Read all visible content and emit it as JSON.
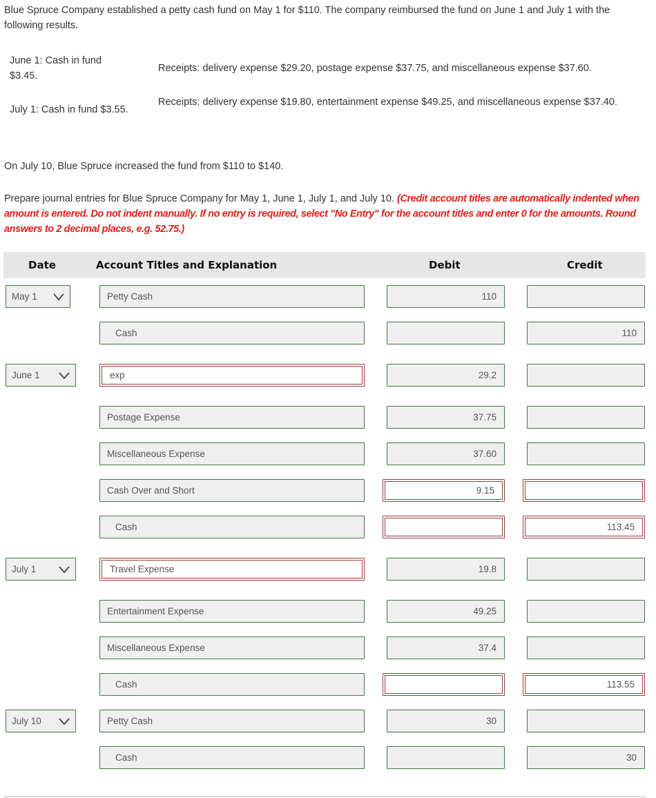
{
  "problem": {
    "intro": "Blue Spruce Company established a petty cash fund on May 1 for $110. The company reimbursed the fund on June 1 and July 1 with the following results.",
    "results": [
      {
        "date": "June 1: Cash in fund $3.45.",
        "receipts": "Receipts: delivery expense $29.20, postage expense $37.75, and miscellaneous expense $37.60."
      },
      {
        "date": "July 1: Cash in fund $3.55.",
        "receipts": "Receipts: delivery expense $19.80, entertainment expense $49.25, and miscellaneous expense $37.40."
      }
    ],
    "increase": "On July 10, Blue Spruce increased the fund from $110 to $140.",
    "instruction_plain": "Prepare journal entries for Blue Spruce Company for May 1, June 1, July 1, and July 10. ",
    "instruction_red": "(Credit account titles are automatically indented when amount is entered. Do not indent manually. If no entry is required, select \"No Entry\" for the account titles and enter 0 for the amounts. Round answers to 2 decimal places, e.g. 52.75.)"
  },
  "table": {
    "headers": {
      "date": "Date",
      "account": "Account Titles and Explanation",
      "debit": "Debit",
      "credit": "Credit"
    },
    "rows": [
      {
        "date": "May 1",
        "account": "Petty Cash",
        "debit": "110",
        "credit": "",
        "indent": false,
        "account_error": false,
        "amount_error": false
      },
      {
        "date": "",
        "account": "Cash",
        "debit": "",
        "credit": "110",
        "indent": true,
        "account_error": false,
        "amount_error": false
      },
      {
        "date": "June 1",
        "account": "exp",
        "debit": "29.2",
        "credit": "",
        "indent": false,
        "account_error": true,
        "amount_error": false
      },
      {
        "date": "",
        "account": "Postage Expense",
        "debit": "37.75",
        "credit": "",
        "indent": false,
        "account_error": false,
        "amount_error": false
      },
      {
        "date": "",
        "account": "Miscellaneous Expense",
        "debit": "37.60",
        "credit": "",
        "indent": false,
        "account_error": false,
        "amount_error": false
      },
      {
        "date": "",
        "account": "Cash Over and Short",
        "debit": "9.15",
        "credit": "",
        "indent": false,
        "account_error": false,
        "amount_error": true
      },
      {
        "date": "",
        "account": "Cash",
        "debit": "",
        "credit": "113.45",
        "indent": true,
        "account_error": false,
        "amount_error": true
      },
      {
        "date": "July 1",
        "account": "Travel Expense",
        "debit": "19.8",
        "credit": "",
        "indent": false,
        "account_error": true,
        "amount_error": false
      },
      {
        "date": "",
        "account": "Entertainment Expense",
        "debit": "49.25",
        "credit": "",
        "indent": false,
        "account_error": false,
        "amount_error": false
      },
      {
        "date": "",
        "account": "Miscellaneous Expense",
        "debit": "37.4",
        "credit": "",
        "indent": false,
        "account_error": false,
        "amount_error": false
      },
      {
        "date": "",
        "account": "Cash",
        "debit": "",
        "credit": "113.55",
        "indent": true,
        "account_error": false,
        "amount_error": true
      },
      {
        "date": "July 10",
        "account": "Petty Cash",
        "debit": "30",
        "credit": "",
        "indent": false,
        "account_error": false,
        "amount_error": false
      },
      {
        "date": "",
        "account": "Cash",
        "debit": "",
        "credit": "30",
        "indent": true,
        "account_error": false,
        "amount_error": false
      }
    ]
  },
  "colors": {
    "correct_border": "#3d7a3d",
    "error_border": "#9b3b3b",
    "instruction_red": "#e0211b",
    "header_bg": "#e6e6e6"
  }
}
